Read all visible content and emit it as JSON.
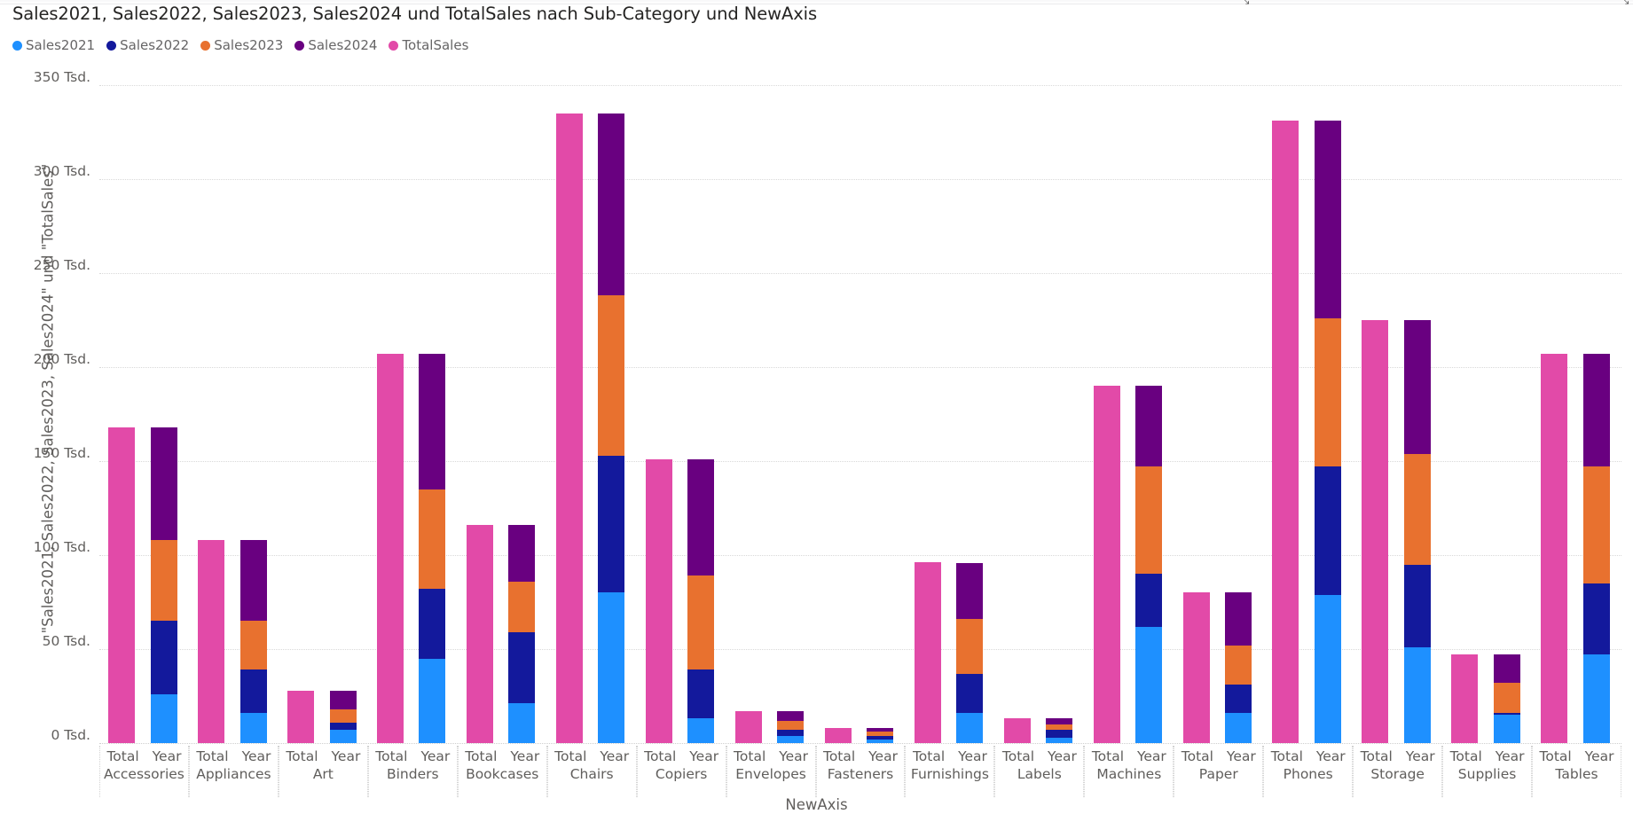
{
  "window": {
    "chrome_mark_left": "⤡",
    "chrome_mark_right": "⤡"
  },
  "header": {
    "title": "Sales2021, Sales2022, Sales2023, Sales2024 und TotalSales nach Sub-Category und NewAxis"
  },
  "chart_data": {
    "type": "bar",
    "subtype": "stacked-grouped",
    "title": "Sales2021, Sales2022, Sales2023, Sales2024 und TotalSales nach Sub-Category und NewAxis",
    "xlabel": "NewAxis",
    "ylabel": "\"Sales2021, Sales2022, Sales2023, Sales2024\" und \"TotalSales\"",
    "ylim": [
      0,
      350000
    ],
    "yticks": [
      0,
      50000,
      100000,
      150000,
      200000,
      250000,
      300000,
      350000
    ],
    "ytick_labels": [
      "0 Tsd.",
      "50 Tsd.",
      "100 Tsd.",
      "150 Tsd.",
      "200 Tsd.",
      "250 Tsd.",
      "300 Tsd.",
      "350 Tsd."
    ],
    "grid": true,
    "legend_position": "top-left",
    "inner_group_labels": [
      "Total",
      "Year"
    ],
    "legend": [
      {
        "name": "Sales2021",
        "color": "#1e90ff"
      },
      {
        "name": "Sales2022",
        "color": "#13199c"
      },
      {
        "name": "Sales2023",
        "color": "#e8712f"
      },
      {
        "name": "Sales2024",
        "color": "#690080"
      },
      {
        "name": "TotalSales",
        "color": "#e24aa8"
      }
    ],
    "series": [
      {
        "name": "Sales2021",
        "color": "#1e90ff",
        "values": [
          26000,
          16000,
          7000,
          45000,
          21000,
          80000,
          13000,
          4000,
          2000,
          16000,
          3000,
          62000,
          16000,
          79000,
          51000,
          15000,
          47000
        ]
      },
      {
        "name": "Sales2022",
        "color": "#13199c",
        "values": [
          39000,
          23000,
          4000,
          37000,
          38000,
          73000,
          26000,
          3000,
          2000,
          21000,
          4000,
          28000,
          15000,
          68000,
          44000,
          1000,
          38000
        ]
      },
      {
        "name": "Sales2023",
        "color": "#e8712f",
        "values": [
          43000,
          26000,
          7000,
          53000,
          27000,
          85000,
          50000,
          5000,
          2000,
          29000,
          3000,
          57000,
          21000,
          79000,
          59000,
          16000,
          62000
        ]
      },
      {
        "name": "Sales2024",
        "color": "#690080",
        "values": [
          60000,
          43000,
          10000,
          72000,
          30000,
          97000,
          62000,
          5000,
          2000,
          30000,
          3000,
          43000,
          28000,
          105000,
          71000,
          15000,
          60000
        ]
      },
      {
        "name": "TotalSales",
        "color": "#e24aa8",
        "values": [
          168000,
          108000,
          28000,
          207000,
          116000,
          335000,
          151000,
          17000,
          8000,
          96000,
          13000,
          190000,
          80000,
          331000,
          225000,
          47000,
          207000
        ]
      }
    ],
    "categories": [
      "Accessories",
      "Appliances",
      "Art",
      "Binders",
      "Bookcases",
      "Chairs",
      "Copiers",
      "Envelopes",
      "Fasteners",
      "Furnishings",
      "Labels",
      "Machines",
      "Paper",
      "Phones",
      "Storage",
      "Supplies",
      "Tables"
    ]
  }
}
